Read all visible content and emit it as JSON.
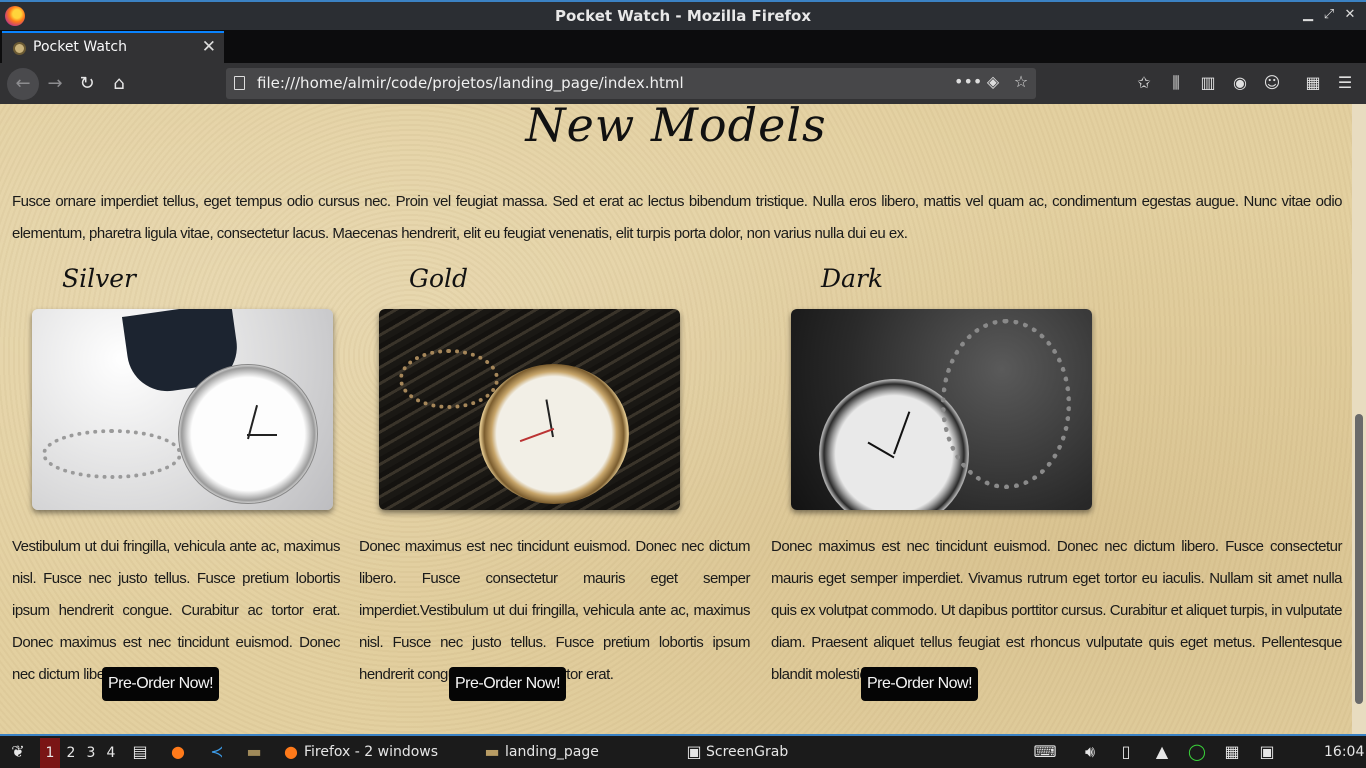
{
  "window": {
    "title": "Pocket Watch - Mozilla Firefox"
  },
  "tab": {
    "label": "Pocket Watch",
    "close": "✕",
    "new_tab": "+"
  },
  "nav": {
    "url": "file:///home/almir/code/projetos/landing_page/index.html",
    "more": "•••"
  },
  "page": {
    "heading": "New Models",
    "intro": "Fusce ornare imperdiet tellus, eget tempus odio cursus nec. Proin vel feugiat massa. Sed et erat ac lectus bibendum tristique. Nulla eros libero, mattis vel quam ac, condimentum egestas augue. Nunc vitae odio elementum, pharetra ligula vitae, consectetur lacus. Maecenas hendrerit, elit eu feugiat venenatis, elit turpis porta dolor, non varius nulla dui eu ex.",
    "models": [
      {
        "name": "Silver",
        "description": "Vestibulum ut dui fringilla, vehicula ante ac, maximus nisl. Fusce nec justo tellus. Fusce pretium lobortis ipsum hendrerit congue. Curabitur ac tortor erat. Donec maximus est nec tincidunt euismod. Donec nec dictum libero. Fusce.",
        "button": "Pre-Order Now!"
      },
      {
        "name": "Gold",
        "description": "Donec maximus est nec tincidunt euismod. Donec nec dictum libero. Fusce consectetur mauris eget semper imperdiet.Vestibulum ut dui fringilla, vehicula ante ac, maximus nisl. Fusce nec justo tellus. Fusce pretium lobortis ipsum hendrerit congue. Curabitur ac tortor erat.",
        "button": "Pre-Order Now!"
      },
      {
        "name": "Dark",
        "description": "Donec maximus est nec tincidunt euismod. Donec nec dictum libero. Fusce consectetur mauris eget semper imperdiet. Vivamus rutrum eget tortor eu iaculis. Nullam sit amet nulla quis ex volutpat commodo. Ut dapibus porttitor cursus. Curabitur et aliquet turpis, in vulputate diam. Praesent aliquet tellus feugiat est rhoncus vulputate quis eget metus. Pellentesque blandit molestie sollicitudin.",
        "button": "Pre-Order Now!"
      }
    ]
  },
  "taskbar": {
    "workspaces": [
      "1",
      "2",
      "3",
      "4"
    ],
    "firefox_task": "Firefox - 2 windows",
    "folder_task": "landing_page",
    "screengrab_task": "ScreenGrab",
    "clock": "16:04"
  },
  "colors": {
    "accent": "#3b82c4",
    "workspace_active": "#7a1515",
    "page_bg": "#e3d0a0",
    "button_bg": "#050505"
  }
}
